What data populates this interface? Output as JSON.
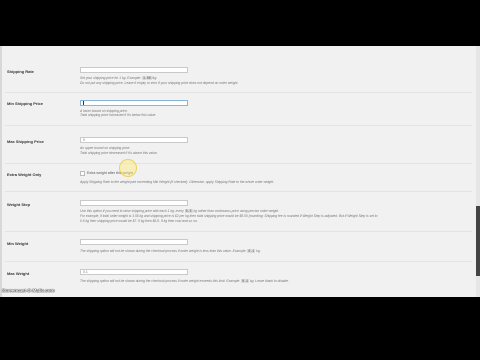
{
  "watermark": "Screencast-O-Matic.com",
  "fields": {
    "shipping_rate": {
      "label": "Shipping Rate",
      "value": "",
      "desc1_pre": "Set your shipping price for 1 kg. Example: ",
      "desc1_code": "1.00",
      "desc1_post": "/kg.",
      "desc2": "Do not put any shipping price. Leave it empty or zero if your shipping price does not depend on order weight."
    },
    "min_shipping_price": {
      "label": "Min Shipping Price",
      "value": "",
      "desc1": "A lower bound on shipping price.",
      "desc2": "Total shipping price increased if it's below this value."
    },
    "max_shipping_price": {
      "label": "Max Shipping Price",
      "value": "0",
      "desc1": "An upper bound on shipping price.",
      "desc2": "Total shipping price decreased if it's above this value."
    },
    "extra_weight_only": {
      "label": "Extra Weight Only",
      "checkbox_label": "Extra weight after this weight",
      "desc1": "Apply Shipping Rate to the weight part exceeding Min Weight (if checked). Otherwise, apply Shipping Rate to the whole order weight."
    },
    "weight_step": {
      "label": "Weight Step",
      "value": "",
      "desc1_pre": "Use this option if you need to raise shipping price with each 1 kg, every ",
      "desc1_code": "0.5",
      "desc1_post": " kg rather than continuous price using precise order weight.",
      "desc2": "For example, if total order weight is 3.55 kg and shipping price is $2 per kg then total shipping price would be $8.00 (rounding: Shipping fee is rounded if Weight Step is adjusted. But if Weight Step is set to",
      "desc3": "0.5 kg then shipping price would be $7. If kg then $6.8. If kg then cost and so on."
    },
    "min_weight": {
      "label": "Min Weight",
      "value": "",
      "desc1_pre": "The shipping option will not be shown during the checkout process if order weight is less than this value. Example: ",
      "desc1_code": "0.1",
      "desc1_post": " kg."
    },
    "max_weight": {
      "label": "Max Weight",
      "value": "0.1",
      "desc1_pre": "The shipping option will not be shown during the checkout process if order weight exceeds this limit. Example: ",
      "desc1_code": "0.1",
      "desc1_post": " kg. Leave blank to disable."
    }
  }
}
